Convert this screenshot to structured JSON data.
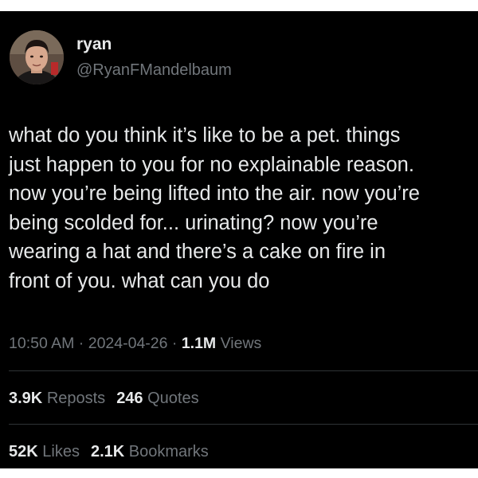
{
  "user": {
    "display_name": "ryan",
    "handle": "@RyanFMandelbaum"
  },
  "tweet": {
    "text": "what do you think it’s like to be a pet. things\njust happen to you for no explainable reason.\nnow you’re being lifted into the air. now you’re\nbeing scolded for... urinating? now you’re\nwearing a hat and there’s a cake on fire in\nfront of you. what can you do"
  },
  "meta": {
    "time": "10:50 AM",
    "separator": " · ",
    "date": "2024-04-26",
    "views_count": "1.1M",
    "views_label": "Views"
  },
  "engagement": {
    "reposts_count": "3.9K",
    "reposts_label": "Reposts",
    "quotes_count": "246",
    "quotes_label": "Quotes",
    "likes_count": "52K",
    "likes_label": "Likes",
    "bookmarks_count": "2.1K",
    "bookmarks_label": "Bookmarks"
  },
  "colors": {
    "background": "#000000",
    "text_primary": "#e7e9ea",
    "text_secondary": "#71767b",
    "divider": "#2f3336"
  }
}
